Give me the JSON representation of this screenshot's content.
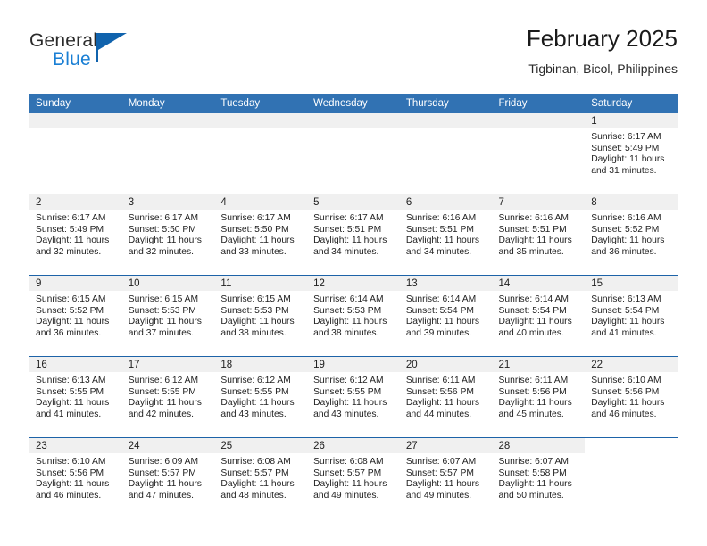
{
  "brand": {
    "word_one": "General",
    "word_two": "Blue",
    "flag_icon": "blue-triangle-flag-icon"
  },
  "header": {
    "title": "February 2025",
    "location": "Tigbinan, Bicol, Philippines"
  },
  "calendar": {
    "weekday_headers": [
      "Sunday",
      "Monday",
      "Tuesday",
      "Wednesday",
      "Thursday",
      "Friday",
      "Saturday"
    ],
    "accent_color": "#3172b3",
    "row_rule_color": "#1d63a8",
    "daynum_band_color": "#f0f0f0",
    "weeks": [
      [
        {
          "type": "empty"
        },
        {
          "type": "empty"
        },
        {
          "type": "empty"
        },
        {
          "type": "empty"
        },
        {
          "type": "empty"
        },
        {
          "type": "empty"
        },
        {
          "type": "day",
          "day": "1",
          "sunrise": "Sunrise: 6:17 AM",
          "sunset": "Sunset: 5:49 PM",
          "daylight": "Daylight: 11 hours and 31 minutes."
        }
      ],
      [
        {
          "type": "day",
          "day": "2",
          "sunrise": "Sunrise: 6:17 AM",
          "sunset": "Sunset: 5:49 PM",
          "daylight": "Daylight: 11 hours and 32 minutes."
        },
        {
          "type": "day",
          "day": "3",
          "sunrise": "Sunrise: 6:17 AM",
          "sunset": "Sunset: 5:50 PM",
          "daylight": "Daylight: 11 hours and 32 minutes."
        },
        {
          "type": "day",
          "day": "4",
          "sunrise": "Sunrise: 6:17 AM",
          "sunset": "Sunset: 5:50 PM",
          "daylight": "Daylight: 11 hours and 33 minutes."
        },
        {
          "type": "day",
          "day": "5",
          "sunrise": "Sunrise: 6:17 AM",
          "sunset": "Sunset: 5:51 PM",
          "daylight": "Daylight: 11 hours and 34 minutes."
        },
        {
          "type": "day",
          "day": "6",
          "sunrise": "Sunrise: 6:16 AM",
          "sunset": "Sunset: 5:51 PM",
          "daylight": "Daylight: 11 hours and 34 minutes."
        },
        {
          "type": "day",
          "day": "7",
          "sunrise": "Sunrise: 6:16 AM",
          "sunset": "Sunset: 5:51 PM",
          "daylight": "Daylight: 11 hours and 35 minutes."
        },
        {
          "type": "day",
          "day": "8",
          "sunrise": "Sunrise: 6:16 AM",
          "sunset": "Sunset: 5:52 PM",
          "daylight": "Daylight: 11 hours and 36 minutes."
        }
      ],
      [
        {
          "type": "day",
          "day": "9",
          "sunrise": "Sunrise: 6:15 AM",
          "sunset": "Sunset: 5:52 PM",
          "daylight": "Daylight: 11 hours and 36 minutes."
        },
        {
          "type": "day",
          "day": "10",
          "sunrise": "Sunrise: 6:15 AM",
          "sunset": "Sunset: 5:53 PM",
          "daylight": "Daylight: 11 hours and 37 minutes."
        },
        {
          "type": "day",
          "day": "11",
          "sunrise": "Sunrise: 6:15 AM",
          "sunset": "Sunset: 5:53 PM",
          "daylight": "Daylight: 11 hours and 38 minutes."
        },
        {
          "type": "day",
          "day": "12",
          "sunrise": "Sunrise: 6:14 AM",
          "sunset": "Sunset: 5:53 PM",
          "daylight": "Daylight: 11 hours and 38 minutes."
        },
        {
          "type": "day",
          "day": "13",
          "sunrise": "Sunrise: 6:14 AM",
          "sunset": "Sunset: 5:54 PM",
          "daylight": "Daylight: 11 hours and 39 minutes."
        },
        {
          "type": "day",
          "day": "14",
          "sunrise": "Sunrise: 6:14 AM",
          "sunset": "Sunset: 5:54 PM",
          "daylight": "Daylight: 11 hours and 40 minutes."
        },
        {
          "type": "day",
          "day": "15",
          "sunrise": "Sunrise: 6:13 AM",
          "sunset": "Sunset: 5:54 PM",
          "daylight": "Daylight: 11 hours and 41 minutes."
        }
      ],
      [
        {
          "type": "day",
          "day": "16",
          "sunrise": "Sunrise: 6:13 AM",
          "sunset": "Sunset: 5:55 PM",
          "daylight": "Daylight: 11 hours and 41 minutes."
        },
        {
          "type": "day",
          "day": "17",
          "sunrise": "Sunrise: 6:12 AM",
          "sunset": "Sunset: 5:55 PM",
          "daylight": "Daylight: 11 hours and 42 minutes."
        },
        {
          "type": "day",
          "day": "18",
          "sunrise": "Sunrise: 6:12 AM",
          "sunset": "Sunset: 5:55 PM",
          "daylight": "Daylight: 11 hours and 43 minutes."
        },
        {
          "type": "day",
          "day": "19",
          "sunrise": "Sunrise: 6:12 AM",
          "sunset": "Sunset: 5:55 PM",
          "daylight": "Daylight: 11 hours and 43 minutes."
        },
        {
          "type": "day",
          "day": "20",
          "sunrise": "Sunrise: 6:11 AM",
          "sunset": "Sunset: 5:56 PM",
          "daylight": "Daylight: 11 hours and 44 minutes."
        },
        {
          "type": "day",
          "day": "21",
          "sunrise": "Sunrise: 6:11 AM",
          "sunset": "Sunset: 5:56 PM",
          "daylight": "Daylight: 11 hours and 45 minutes."
        },
        {
          "type": "day",
          "day": "22",
          "sunrise": "Sunrise: 6:10 AM",
          "sunset": "Sunset: 5:56 PM",
          "daylight": "Daylight: 11 hours and 46 minutes."
        }
      ],
      [
        {
          "type": "day",
          "day": "23",
          "sunrise": "Sunrise: 6:10 AM",
          "sunset": "Sunset: 5:56 PM",
          "daylight": "Daylight: 11 hours and 46 minutes."
        },
        {
          "type": "day",
          "day": "24",
          "sunrise": "Sunrise: 6:09 AM",
          "sunset": "Sunset: 5:57 PM",
          "daylight": "Daylight: 11 hours and 47 minutes."
        },
        {
          "type": "day",
          "day": "25",
          "sunrise": "Sunrise: 6:08 AM",
          "sunset": "Sunset: 5:57 PM",
          "daylight": "Daylight: 11 hours and 48 minutes."
        },
        {
          "type": "day",
          "day": "26",
          "sunrise": "Sunrise: 6:08 AM",
          "sunset": "Sunset: 5:57 PM",
          "daylight": "Daylight: 11 hours and 49 minutes."
        },
        {
          "type": "day",
          "day": "27",
          "sunrise": "Sunrise: 6:07 AM",
          "sunset": "Sunset: 5:57 PM",
          "daylight": "Daylight: 11 hours and 49 minutes."
        },
        {
          "type": "day",
          "day": "28",
          "sunrise": "Sunrise: 6:07 AM",
          "sunset": "Sunset: 5:58 PM",
          "daylight": "Daylight: 11 hours and 50 minutes."
        },
        {
          "type": "blank"
        }
      ]
    ]
  }
}
